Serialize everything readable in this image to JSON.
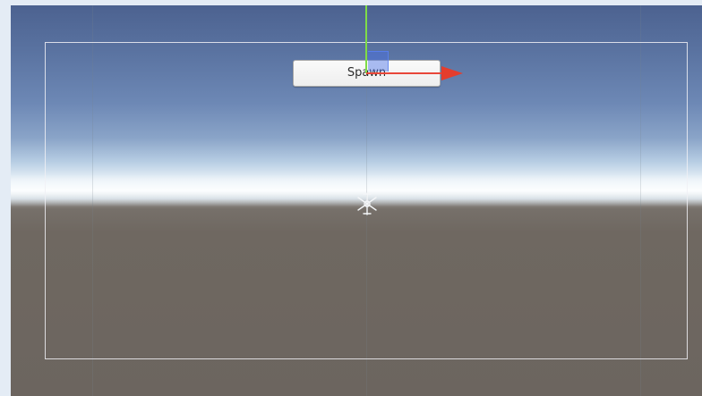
{
  "scene": {
    "button_label": "Spawn",
    "colors": {
      "page_background": "#e4ecf5",
      "sky_top": "#4c6290",
      "horizon": "#f7fbfd",
      "ground": "#6c655f",
      "canvas_frame": "#f0f0f5",
      "gizmo_x": "#e8473a",
      "gizmo_y": "#7fdc48",
      "gizmo_plane": "#466ee6"
    },
    "icons": [
      "move-gizmo-x-arrow-icon",
      "move-gizmo-y-axis-icon",
      "move-gizmo-plane-icon",
      "pivot-light-icon"
    ]
  }
}
